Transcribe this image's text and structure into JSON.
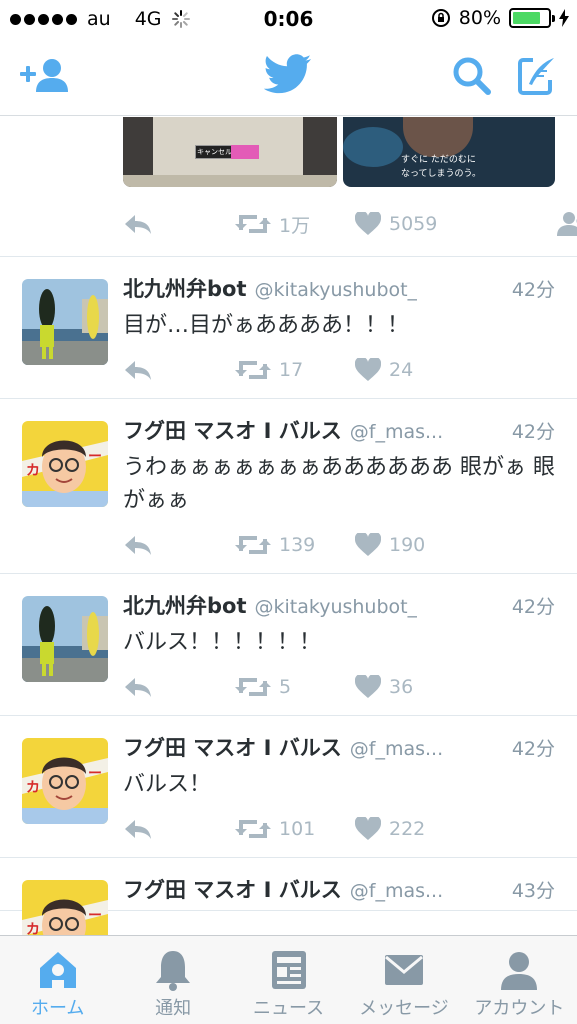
{
  "status": {
    "carrier": "au",
    "network": "4G",
    "time": "0:06",
    "battery": "80%"
  },
  "colors": {
    "accent": "#55acee",
    "icon_gray": "#aab8c2",
    "text": "#292f33",
    "subtle": "#8899a6"
  },
  "top_tweet": {
    "image_caption": "すぐに ただのむに\nなってしまうのう。",
    "dialog_cancel": "キャンセル",
    "retweets": "1万",
    "likes": "5059"
  },
  "tweets": [
    {
      "name": "北九州弁bot",
      "handle": "@kitakyushubot_",
      "time": "42分",
      "text": "目が…目がぁああああ！！！",
      "retweets": "17",
      "likes": "24",
      "avatar": "bot-figure"
    },
    {
      "name": "フグ田 マスオ I バルス",
      "handle": "@f_mas...",
      "time": "42分",
      "text": "うわぁぁぁぁぁぁぁああああああ 眼がぁ 眼がぁぁ",
      "retweets": "139",
      "likes": "190",
      "avatar": "masuo"
    },
    {
      "name": "北九州弁bot",
      "handle": "@kitakyushubot_",
      "time": "42分",
      "text": "バルス！！！！！！",
      "retweets": "5",
      "likes": "36",
      "avatar": "bot-figure"
    },
    {
      "name": "フグ田 マスオ I バルス",
      "handle": "@f_mas...",
      "time": "42分",
      "text": "バルス！",
      "retweets": "101",
      "likes": "222",
      "avatar": "masuo"
    },
    {
      "name": "フグ田 マスオ I バルス",
      "handle": "@f_mas...",
      "time": "43分",
      "text": "",
      "retweets": "",
      "likes": "",
      "avatar": "masuo"
    }
  ],
  "tabs": [
    {
      "label": "ホーム",
      "icon": "home-icon",
      "active": true
    },
    {
      "label": "通知",
      "icon": "bell-icon",
      "active": false
    },
    {
      "label": "ニュース",
      "icon": "news-icon",
      "active": false
    },
    {
      "label": "メッセージ",
      "icon": "envelope-icon",
      "active": false
    },
    {
      "label": "アカウント",
      "icon": "person-icon",
      "active": false
    }
  ]
}
